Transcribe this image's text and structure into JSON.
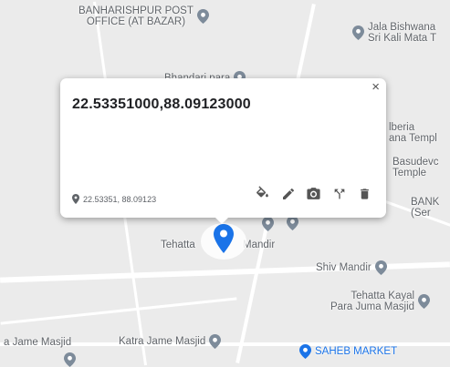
{
  "map": {
    "pois": [
      {
        "id": "banharishpur",
        "label_lines": [
          "BANHARISHPUR POST",
          "OFFICE (AT BAZAR)"
        ]
      },
      {
        "id": "jala-bishwana",
        "label_lines": [
          "Jala Bishwana",
          "Sri Kali Mata T"
        ]
      },
      {
        "id": "bhandari-para",
        "label_lines": [
          "Bhandari para"
        ]
      },
      {
        "id": "jaberia",
        "label_lines": [
          "lberia",
          "ana Templ"
        ]
      },
      {
        "id": "basudev",
        "label_lines": [
          "Basudevc",
          "Temple"
        ]
      },
      {
        "id": "bank",
        "label_lines": [
          "BANK",
          "(Ser"
        ]
      },
      {
        "id": "tehatta",
        "label_lines": [
          "Tehatta"
        ]
      },
      {
        "id": "mandir",
        "label_lines": [
          "Mandir"
        ]
      },
      {
        "id": "shiv-mandir",
        "label_lines": [
          "Shiv Mandir"
        ]
      },
      {
        "id": "tehatta-kayal",
        "label_lines": [
          "Tehatta Kayal",
          "Para Juma Masjid"
        ]
      },
      {
        "id": "jame-masjid",
        "label_lines": [
          "a Jame Masjid"
        ]
      },
      {
        "id": "katra-jame-masjid",
        "label_lines": [
          "Katra Jame Masjid"
        ]
      },
      {
        "id": "saheb-market",
        "label_lines": [
          "SAHEB MARKET"
        ]
      }
    ]
  },
  "popup": {
    "title": "22.53351000,88.09123000",
    "close_label": "×",
    "footer_coords": "22.53351, 88.09123",
    "actions": [
      {
        "id": "paint",
        "icon": "paint-bucket-icon"
      },
      {
        "id": "edit",
        "icon": "pencil-icon"
      },
      {
        "id": "photo",
        "icon": "camera-icon"
      },
      {
        "id": "directions",
        "icon": "fork-icon"
      },
      {
        "id": "delete",
        "icon": "trash-icon"
      }
    ]
  },
  "colors": {
    "accent_blue": "#1a73e8",
    "poi_pin": "#7d8b9a",
    "text_gray": "#5f6368"
  }
}
